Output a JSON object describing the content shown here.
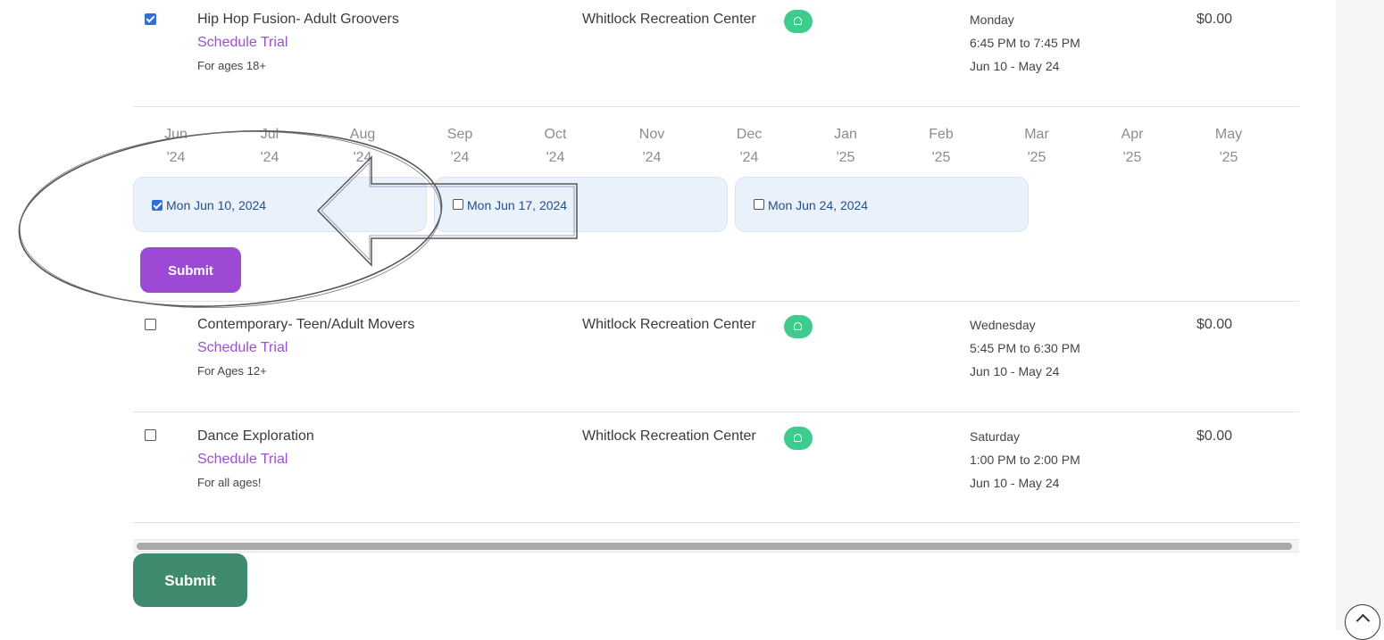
{
  "classes": [
    {
      "checked": true,
      "name": "Hip Hop Fusion- Adult Groovers",
      "trial": "Schedule Trial",
      "ages": "For ages 18+",
      "location": "Whitlock Recreation Center",
      "day": "Monday",
      "time": "6:45 PM to 7:45 PM",
      "range": "Jun 10 - May 24",
      "price": "$0.00"
    },
    {
      "checked": false,
      "name": "Contemporary- Teen/Adult Movers",
      "trial": "Schedule Trial",
      "ages": "For Ages 12+",
      "location": "Whitlock Recreation Center",
      "day": "Wednesday",
      "time": "5:45 PM to 6:30 PM",
      "range": "Jun 10 - May 24",
      "price": "$0.00"
    },
    {
      "checked": false,
      "name": "Dance Exploration",
      "trial": "Schedule Trial",
      "ages": "For all ages!",
      "location": "Whitlock Recreation Center",
      "day": "Saturday",
      "time": "1:00 PM to 2:00 PM",
      "range": "Jun 10 - May 24",
      "price": "$0.00"
    }
  ],
  "months": [
    {
      "m": "Jun",
      "y": "'24"
    },
    {
      "m": "Jul",
      "y": "'24"
    },
    {
      "m": "Aug",
      "y": "'24"
    },
    {
      "m": "Sep",
      "y": "'24"
    },
    {
      "m": "Oct",
      "y": "'24"
    },
    {
      "m": "Nov",
      "y": "'24"
    },
    {
      "m": "Dec",
      "y": "'24"
    },
    {
      "m": "Jan",
      "y": "'25"
    },
    {
      "m": "Feb",
      "y": "'25"
    },
    {
      "m": "Mar",
      "y": "'25"
    },
    {
      "m": "Apr",
      "y": "'25"
    },
    {
      "m": "May",
      "y": "'25"
    }
  ],
  "dates": [
    {
      "label": "Mon Jun 10, 2024",
      "checked": true
    },
    {
      "label": "Mon Jun 17, 2024",
      "checked": false
    },
    {
      "label": "Mon Jun 24, 2024",
      "checked": false
    }
  ],
  "buttons": {
    "submit_dates": "Submit",
    "submit_main": "Submit"
  },
  "colors": {
    "accent_purple": "#9c4ad6",
    "submit_green": "#3f8a6c",
    "location_badge": "#3ecb8d",
    "date_pill_bg": "#e9f1fb"
  },
  "icons": {
    "location_badge": "home-icon",
    "back_to_top": "chevron-up-icon"
  }
}
